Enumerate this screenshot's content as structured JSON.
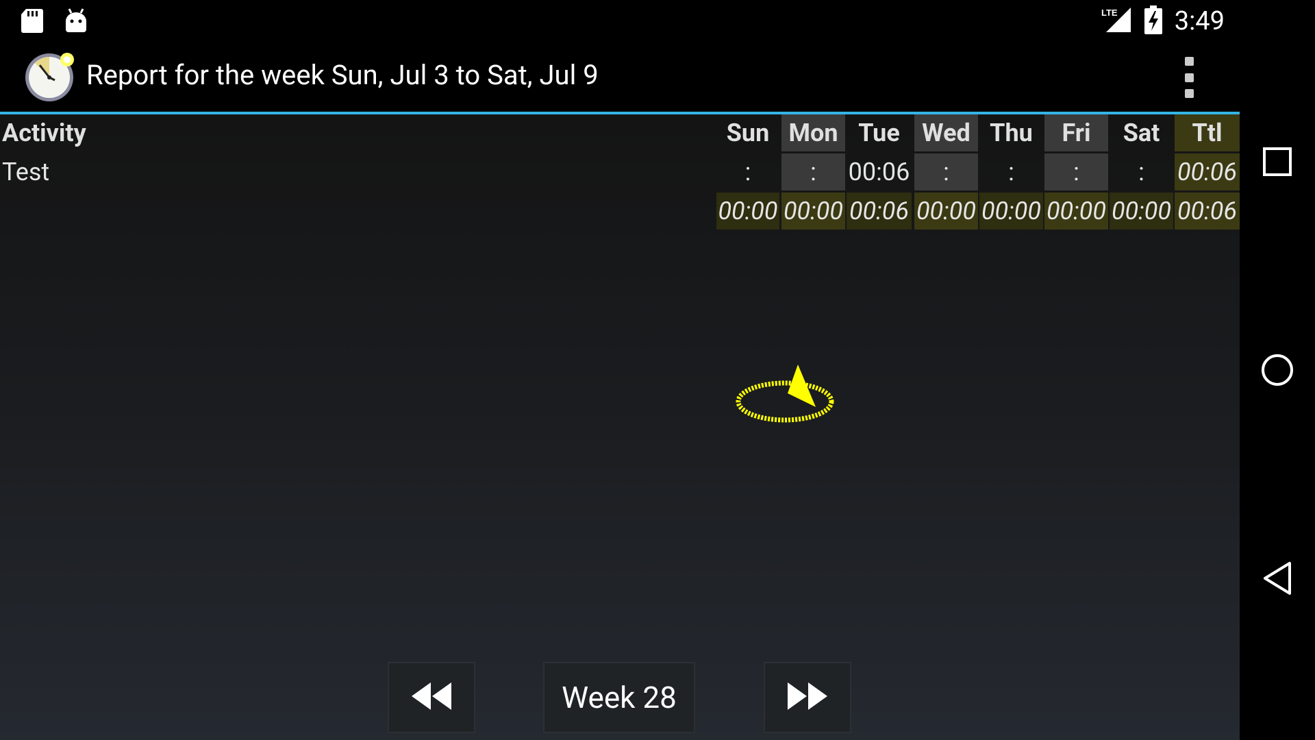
{
  "status_bar": {
    "time": "3:49",
    "network": "LTE",
    "left_icons": [
      "sd-card-icon",
      "android-debug-icon"
    ],
    "right_icons": [
      "lte-signal-icon",
      "battery-charging-icon"
    ]
  },
  "app_bar": {
    "title": "Report for the week Sun, Jul 3 to Sat, Jul 9",
    "menu_icon": "overflow-menu-icon",
    "accent_color": "#33b5e5"
  },
  "report": {
    "activity_header": "Activity",
    "day_headers": [
      "Sun",
      "Mon",
      "Tue",
      "Wed",
      "Thu",
      "Fri",
      "Sat",
      "Ttl"
    ],
    "rows": [
      {
        "activity": "Test",
        "values": [
          ":",
          ":",
          "00:06",
          ":",
          ":",
          ":",
          ":",
          "00:06"
        ]
      }
    ],
    "totals": [
      "00:00",
      "00:00",
      "00:06",
      "00:00",
      "00:00",
      "00:00",
      "00:00",
      "00:06"
    ]
  },
  "navigation": {
    "prev_icon": "rewind-icon",
    "week_label": "Week 28",
    "next_icon": "fast-forward-icon"
  },
  "system_nav": {
    "recents_icon": "recents-square-icon",
    "home_icon": "home-circle-icon",
    "back_icon": "back-triangle-icon"
  },
  "colors": {
    "shaded_column": "#3a3a3a",
    "total_highlight": "#3b3a13",
    "spinner": "#ffff00"
  }
}
